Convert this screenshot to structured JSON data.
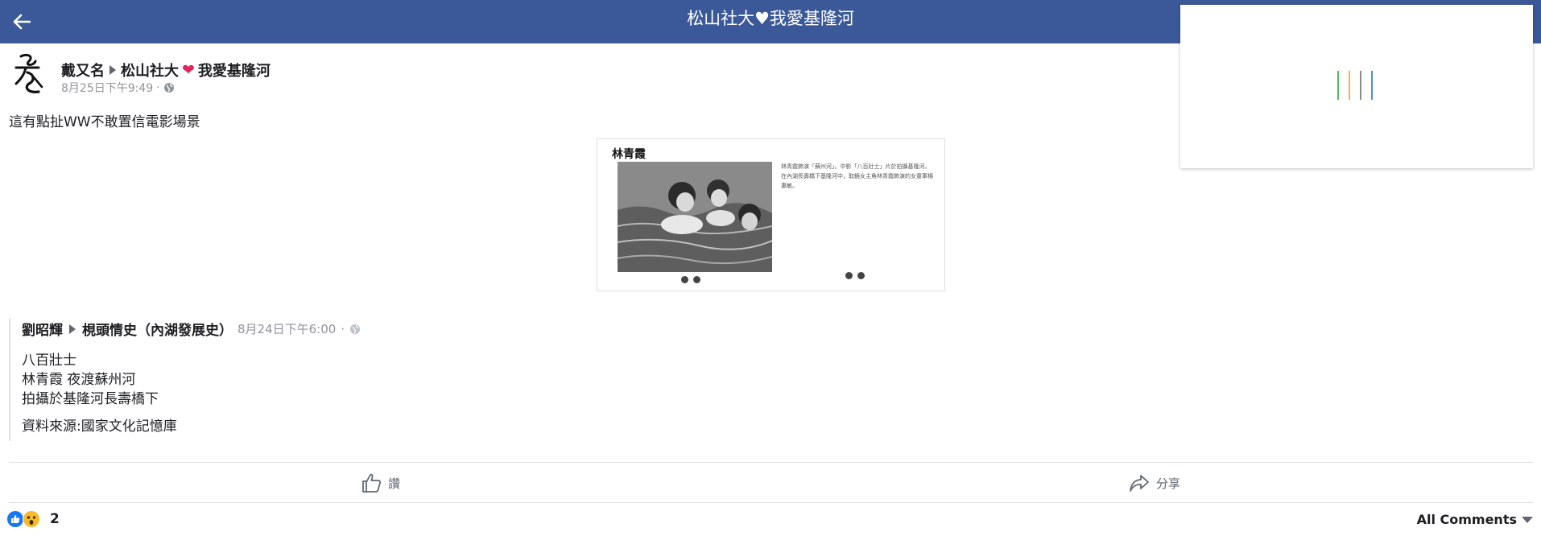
{
  "topbar": {
    "title": "松山社大♥我愛基隆河",
    "background": "#3b5998"
  },
  "loading": {
    "spinner_colors": [
      "#5ab46e",
      "#f3b33d",
      "#8b8b8b",
      "#4a90d9"
    ]
  },
  "post": {
    "author": "戴又名",
    "group": "松山社大",
    "group_suffix": "我愛基隆河",
    "timestamp": "8月25日下午9:49",
    "meta_separator": "·",
    "text": "這有點扯WW不敢置信電影場景"
  },
  "image": {
    "title": "林青霞",
    "caption": "林青霞飾演「蘇州河」。中影「八百壯士」片於拍攝基隆河，在內湖長壽橋下基隆河中，取鏡女主角林青霞飾演的女童軍楊惠敏。"
  },
  "shared": {
    "author": "劉昭輝",
    "group": "梘頭情史（內湖發展史）",
    "timestamp": "8月24日下午6:00",
    "meta_separator": "·",
    "lines": [
      "八百壯士",
      "林青霞 夜渡蘇州河",
      "拍攝於基隆河長壽橋下"
    ],
    "source": "資料來源:國家文化記憶庫"
  },
  "actions": {
    "like_label": "讚",
    "share_label": "分享"
  },
  "footer": {
    "reaction_count": "2",
    "comments_label": "All Comments"
  }
}
